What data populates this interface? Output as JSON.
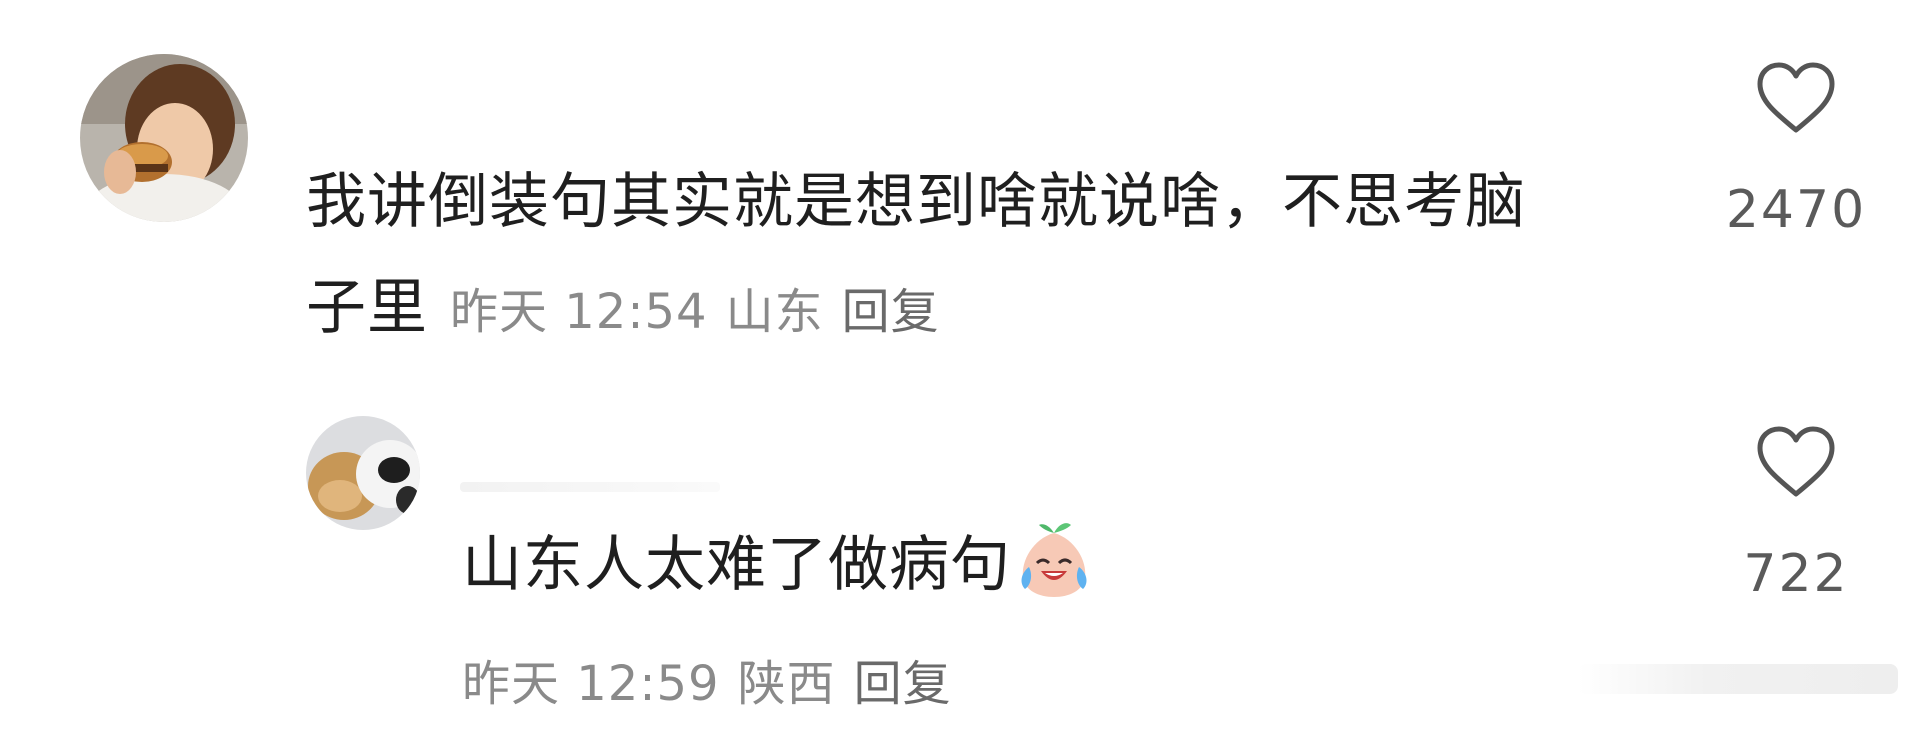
{
  "comments": [
    {
      "avatar": "avatar-girl-eating-burger",
      "text_line1": "我讲倒装句其实就是想到啥就说啥，不思考脑",
      "text_line2": "子里",
      "time": "昨天 12:54",
      "location": "山东",
      "reply_label": "回复",
      "likes": "2470",
      "like_icon": "heart-outline-icon"
    },
    {
      "avatar": "avatar-dog-and-cat",
      "text": "山东人太难了做病句",
      "emoji": "crying-laughing-peach-emoji",
      "time": "昨天 12:59",
      "location": "陕西",
      "reply_label": "回复",
      "likes": "722",
      "like_icon": "heart-outline-icon"
    }
  ],
  "colors": {
    "text": "#1f1f1f",
    "meta": "#8a8a8a",
    "icon": "#555555"
  }
}
